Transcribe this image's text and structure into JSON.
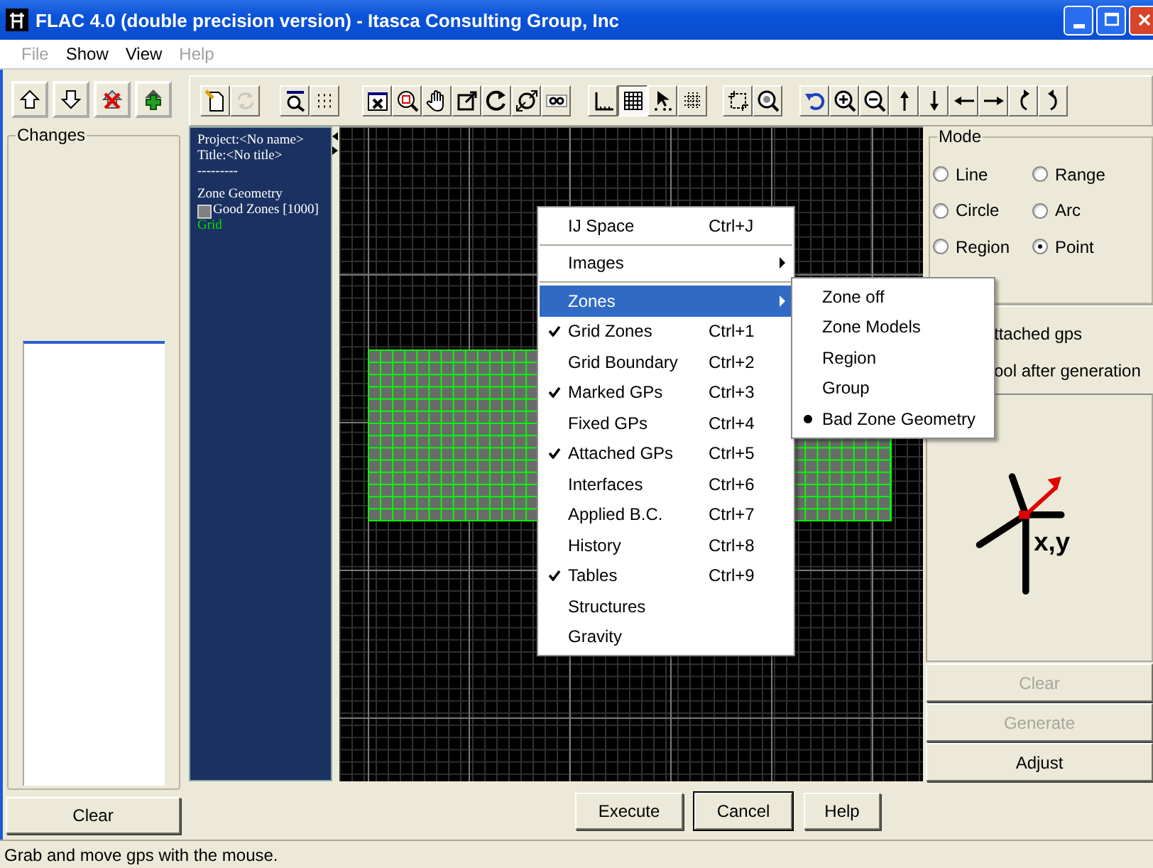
{
  "window": {
    "title": "FLAC 4.0 (double precision version) - Itasca Consulting Group, Inc"
  },
  "menu_bar": [
    {
      "label": "File",
      "disabled": true
    },
    {
      "label": "Show",
      "disabled": false
    },
    {
      "label": "View",
      "disabled": false
    },
    {
      "label": "Help",
      "disabled": true
    }
  ],
  "toolbar": [
    {
      "pressed": false,
      "disabled": false
    },
    {
      "pressed": false,
      "disabled": true
    },
    {
      "pressed": false,
      "disabled": false
    },
    {
      "pressed": false,
      "disabled": false
    },
    {
      "pressed": false,
      "disabled": false
    },
    {
      "pressed": false,
      "disabled": false
    },
    {
      "pressed": false,
      "disabled": false
    },
    {
      "pressed": false,
      "disabled": false
    },
    {
      "pressed": false,
      "disabled": false
    },
    {
      "pressed": false,
      "disabled": false
    },
    {
      "pressed": false,
      "disabled": false
    },
    {
      "pressed": false,
      "disabled": false
    },
    {
      "pressed": true,
      "disabled": false
    },
    {
      "pressed": false,
      "disabled": false
    },
    {
      "pressed": false,
      "disabled": false
    },
    {
      "pressed": false,
      "disabled": false
    },
    {
      "pressed": false,
      "disabled": false
    },
    {
      "pressed": false,
      "disabled": false
    },
    {
      "pressed": false,
      "disabled": false
    },
    {
      "pressed": false,
      "disabled": false
    },
    {
      "pressed": false,
      "disabled": false
    },
    {
      "pressed": false,
      "disabled": false
    },
    {
      "pressed": false,
      "disabled": false
    },
    {
      "pressed": false,
      "disabled": false
    },
    {
      "pressed": false,
      "disabled": false
    },
    {
      "pressed": false,
      "disabled": false
    }
  ],
  "changes": {
    "title": "Changes",
    "clear_button": "Clear"
  },
  "info_panel": {
    "lines": [
      "Project:<No name>",
      "Title:<No title>",
      "---------"
    ],
    "heading": "Zone Geometry",
    "legend": [
      {
        "label": "Good Zones [1000]",
        "color": "#808080"
      }
    ],
    "grid_label": "Grid"
  },
  "context_menu": {
    "items": [
      {
        "kind": "item",
        "label": "IJ Space",
        "shortcut": "Ctrl+J",
        "checked": false,
        "submenu": false,
        "selected": false
      },
      {
        "kind": "separator"
      },
      {
        "kind": "item",
        "label": "Images",
        "checked": false,
        "submenu": true,
        "selected": false
      },
      {
        "kind": "separator"
      },
      {
        "kind": "item",
        "label": "Zones",
        "checked": false,
        "submenu": true,
        "selected": true
      },
      {
        "kind": "item",
        "label": "Grid Zones",
        "shortcut": "Ctrl+1",
        "checked": true,
        "submenu": false,
        "selected": false
      },
      {
        "kind": "item",
        "label": "Grid Boundary",
        "shortcut": "Ctrl+2",
        "checked": false,
        "submenu": false,
        "selected": false
      },
      {
        "kind": "item",
        "label": "Marked GPs",
        "shortcut": "Ctrl+3",
        "checked": true,
        "submenu": false,
        "selected": false
      },
      {
        "kind": "item",
        "label": "Fixed GPs",
        "shortcut": "Ctrl+4",
        "checked": false,
        "submenu": false,
        "selected": false
      },
      {
        "kind": "item",
        "label": "Attached GPs",
        "shortcut": "Ctrl+5",
        "checked": true,
        "submenu": false,
        "selected": false
      },
      {
        "kind": "item",
        "label": "Interfaces",
        "shortcut": "Ctrl+6",
        "checked": false,
        "submenu": false,
        "selected": false
      },
      {
        "kind": "item",
        "label": "Applied B.C.",
        "shortcut": "Ctrl+7",
        "checked": false,
        "submenu": false,
        "selected": false
      },
      {
        "kind": "item",
        "label": "History",
        "shortcut": "Ctrl+8",
        "checked": false,
        "submenu": false,
        "selected": false
      },
      {
        "kind": "item",
        "label": "Tables",
        "shortcut": "Ctrl+9",
        "checked": true,
        "submenu": false,
        "selected": false
      },
      {
        "kind": "item",
        "label": "Structures",
        "checked": false,
        "submenu": false,
        "selected": false
      },
      {
        "kind": "item",
        "label": "Gravity",
        "checked": false,
        "submenu": false,
        "selected": false
      }
    ]
  },
  "submenu": {
    "items": [
      {
        "label": "Zone off",
        "selected": false
      },
      {
        "label": "Zone Models",
        "selected": false
      },
      {
        "label": "Region",
        "selected": false
      },
      {
        "label": "Group",
        "selected": false
      },
      {
        "label": "Bad Zone Geometry",
        "selected": true
      }
    ]
  },
  "mode": {
    "title": "Mode",
    "options": [
      {
        "label": "Line",
        "selected": false
      },
      {
        "label": "Range",
        "selected": false
      },
      {
        "label": "Circle",
        "selected": false
      },
      {
        "label": "Arc",
        "selected": false
      },
      {
        "label": "Region",
        "selected": false
      },
      {
        "label": "Point",
        "selected": true
      }
    ]
  },
  "option_texts": [
    "ttached gps",
    "ool after generation"
  ],
  "axes_label": "x,y",
  "side_buttons": [
    {
      "label": "Clear",
      "disabled": true
    },
    {
      "label": "Generate",
      "disabled": true
    },
    {
      "label": "Adjust",
      "disabled": false
    }
  ],
  "dialog_buttons": [
    {
      "label": "Execute",
      "default": false
    },
    {
      "label": "Cancel",
      "default": true
    },
    {
      "label": "Help",
      "default": false
    }
  ],
  "status_bar": "Grab and move gps with the mouse."
}
